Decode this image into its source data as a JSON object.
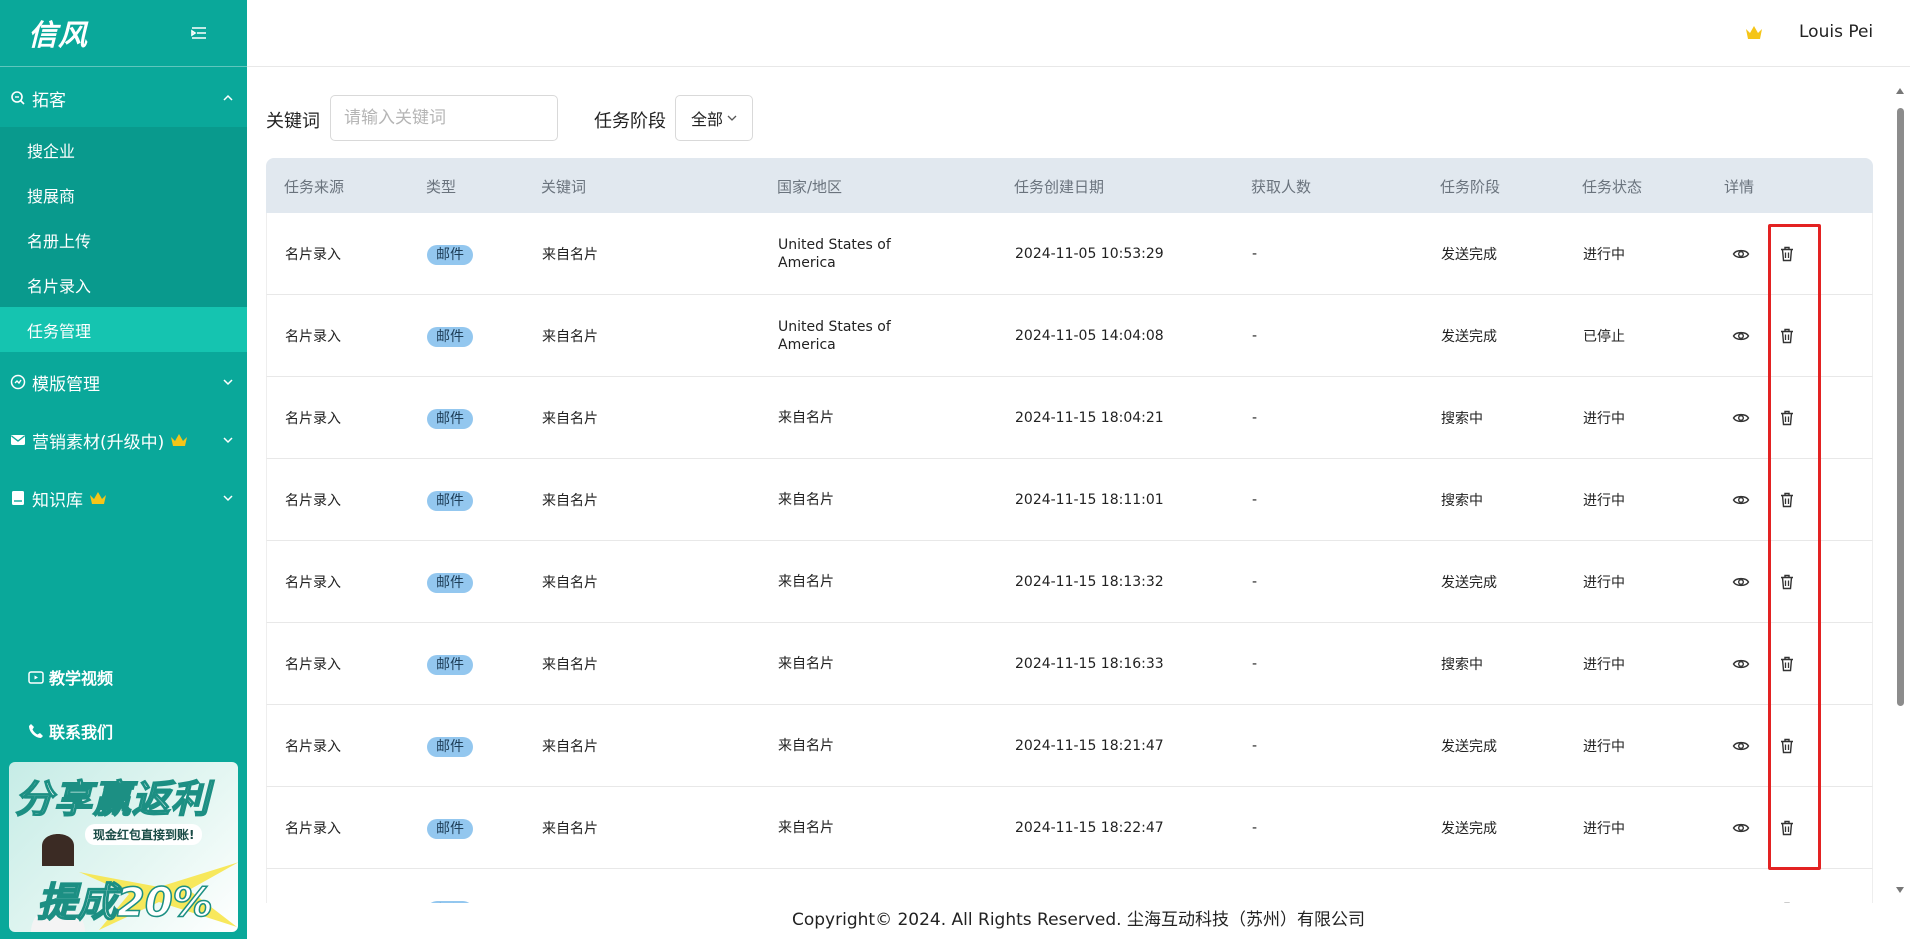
{
  "app": {
    "logo": "信风",
    "user": "Louis Pei"
  },
  "sidebar": {
    "group_prospect": {
      "label": "拓客",
      "items": [
        "搜企业",
        "搜展商",
        "名册上传",
        "名片录入",
        "任务管理"
      ],
      "active": "任务管理"
    },
    "group_template": {
      "label": "模版管理"
    },
    "group_marketing": {
      "label": "营销素材(升级中)"
    },
    "group_knowledge": {
      "label": "知识库"
    },
    "tutorial": "教学视频",
    "contact": "联系我们",
    "promo": {
      "title": "分享赢返利",
      "subtitle": "现金红包直接到账!",
      "bonus": "提成20%"
    }
  },
  "filters": {
    "keyword_label": "关键词",
    "keyword_placeholder": "请输入关键词",
    "keyword_value": "",
    "stage_label": "任务阶段",
    "stage_value": "全部"
  },
  "table": {
    "headers": [
      "任务来源",
      "类型",
      "关键词",
      "国家/地区",
      "任务创建日期",
      "获取人数",
      "任务阶段",
      "任务状态",
      "详情"
    ],
    "rows": [
      {
        "source": "名片录入",
        "type": "邮件",
        "keyword": "来自名片",
        "country": "United States of America",
        "date": "2024-11-05 10:53:29",
        "count": "-",
        "stage": "发送完成",
        "status": "进行中"
      },
      {
        "source": "名片录入",
        "type": "邮件",
        "keyword": "来自名片",
        "country": "United States of America",
        "date": "2024-11-05 14:04:08",
        "count": "-",
        "stage": "发送完成",
        "status": "已停止"
      },
      {
        "source": "名片录入",
        "type": "邮件",
        "keyword": "来自名片",
        "country": "来自名片",
        "date": "2024-11-15 18:04:21",
        "count": "-",
        "stage": "搜索中",
        "status": "进行中"
      },
      {
        "source": "名片录入",
        "type": "邮件",
        "keyword": "来自名片",
        "country": "来自名片",
        "date": "2024-11-15 18:11:01",
        "count": "-",
        "stage": "搜索中",
        "status": "进行中"
      },
      {
        "source": "名片录入",
        "type": "邮件",
        "keyword": "来自名片",
        "country": "来自名片",
        "date": "2024-11-15 18:13:32",
        "count": "-",
        "stage": "发送完成",
        "status": "进行中"
      },
      {
        "source": "名片录入",
        "type": "邮件",
        "keyword": "来自名片",
        "country": "来自名片",
        "date": "2024-11-15 18:16:33",
        "count": "-",
        "stage": "搜索中",
        "status": "进行中"
      },
      {
        "source": "名片录入",
        "type": "邮件",
        "keyword": "来自名片",
        "country": "来自名片",
        "date": "2024-11-15 18:21:47",
        "count": "-",
        "stage": "发送完成",
        "status": "进行中"
      },
      {
        "source": "名片录入",
        "type": "邮件",
        "keyword": "来自名片",
        "country": "来自名片",
        "date": "2024-11-15 18:22:47",
        "count": "-",
        "stage": "发送完成",
        "status": "进行中"
      },
      {
        "source": "",
        "type": "邮件",
        "keyword": "",
        "country": "",
        "date": "",
        "count": "",
        "stage": "",
        "status": ""
      }
    ]
  },
  "footer": "Copyright© 2024. All Rights Reserved. 尘海互动科技（苏州）有限公司",
  "colors": {
    "sidebar": "#0aa89a",
    "active_item": "#15c4b0",
    "badge": "#93c7ef",
    "highlight": "#e32222"
  },
  "icons": [
    "collapse-icon",
    "search-doc-icon",
    "chevron-up-icon",
    "chevron-down-icon",
    "template-icon",
    "mail-icon",
    "book-icon",
    "crown-icon",
    "video-icon",
    "phone-icon",
    "eye-icon",
    "trash-icon"
  ]
}
